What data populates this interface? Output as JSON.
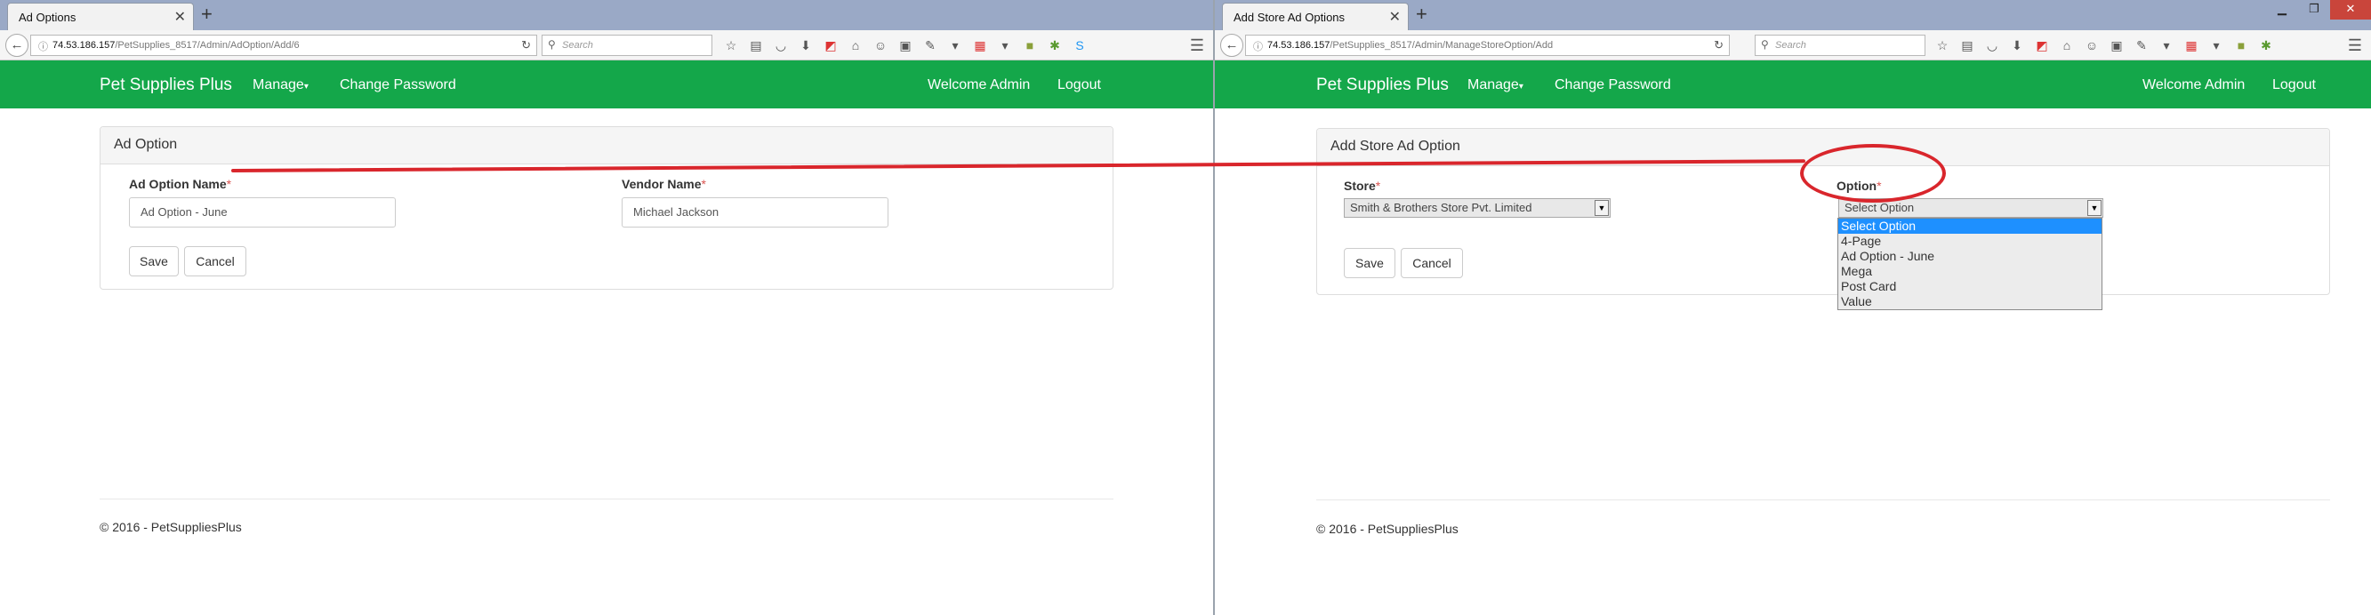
{
  "left": {
    "tab_title": "Ad Options",
    "url_host": "74.53.186.157",
    "url_path": "/PetSupplies_8517/Admin/AdOption/Add/6",
    "search_placeholder": "Search",
    "brand": "Pet Supplies Plus",
    "nav": {
      "manage": "Manage",
      "change_password": "Change Password",
      "welcome": "Welcome Admin",
      "logout": "Logout"
    },
    "panel_title": "Ad Option",
    "fields": {
      "ad_option_name_label": "Ad Option Name",
      "ad_option_name_value": "Ad Option - June",
      "vendor_name_label": "Vendor Name",
      "vendor_name_value": "Michael Jackson"
    },
    "buttons": {
      "save": "Save",
      "cancel": "Cancel"
    },
    "footer": "© 2016 - PetSuppliesPlus"
  },
  "right": {
    "tab_title": "Add Store Ad Options",
    "url_host": "74.53.186.157",
    "url_path": "/PetSupplies_8517/Admin/ManageStoreOption/Add",
    "search_placeholder": "Search",
    "brand": "Pet Supplies Plus",
    "nav": {
      "manage": "Manage",
      "change_password": "Change Password",
      "welcome": "Welcome Admin",
      "logout": "Logout"
    },
    "panel_title": "Add Store Ad Option",
    "fields": {
      "store_label": "Store",
      "store_value": "Smith & Brothers Store Pvt. Limited",
      "option_label": "Option",
      "option_value": "Select Option",
      "option_list": [
        "Select Option",
        "4-Page",
        "Ad Option - June",
        "Mega",
        "Post Card",
        "Value"
      ]
    },
    "buttons": {
      "save": "Save",
      "cancel": "Cancel"
    },
    "footer": "© 2016 - PetSuppliesPlus"
  },
  "required_mark": "*",
  "colors": {
    "navbar": "#14a74a",
    "annotation": "#d9262c",
    "required": "#d9534f",
    "selected_option": "#1e90ff"
  }
}
